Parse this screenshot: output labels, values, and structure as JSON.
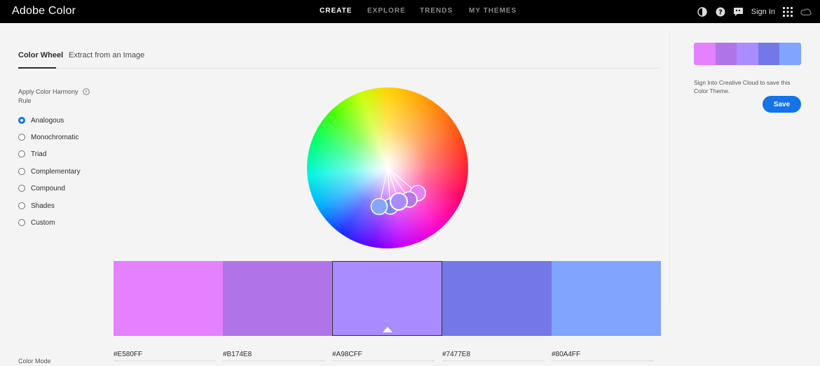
{
  "app": {
    "title": "Adobe Color"
  },
  "nav": [
    {
      "label": "CREATE",
      "active": true
    },
    {
      "label": "EXPLORE",
      "active": false
    },
    {
      "label": "TRENDS",
      "active": false
    },
    {
      "label": "MY THEMES",
      "active": false
    }
  ],
  "topbar": {
    "sign_in": "Sign In",
    "icons": [
      "contrast-icon",
      "help-icon",
      "chat-icon",
      "apps-grid-icon",
      "creative-cloud-icon"
    ]
  },
  "tabs": [
    {
      "label": "Color Wheel",
      "active": true
    },
    {
      "label": "Extract from an Image",
      "active": false
    }
  ],
  "harmony": {
    "label": "Apply Color Harmony Rule",
    "selected": "Analogous",
    "rules": [
      "Analogous",
      "Monochromatic",
      "Triad",
      "Complementary",
      "Compound",
      "Shades",
      "Custom"
    ]
  },
  "swatches": [
    {
      "hex": "#E580FF",
      "color": "#E580FF"
    },
    {
      "hex": "#B174E8",
      "color": "#B174E8"
    },
    {
      "hex": "#A98CFF",
      "color": "#A98CFF",
      "selected": true
    },
    {
      "hex": "#7477E8",
      "color": "#7477E8"
    },
    {
      "hex": "#80A4FF",
      "color": "#80A4FF"
    }
  ],
  "color_mode_label": "Color Mode",
  "right_panel": {
    "save_message": "Sign Into Creative Cloud to save this Color Theme.",
    "save_label": "Save"
  },
  "colors": {
    "accent": "#1473e6",
    "topbar": "#000000"
  }
}
